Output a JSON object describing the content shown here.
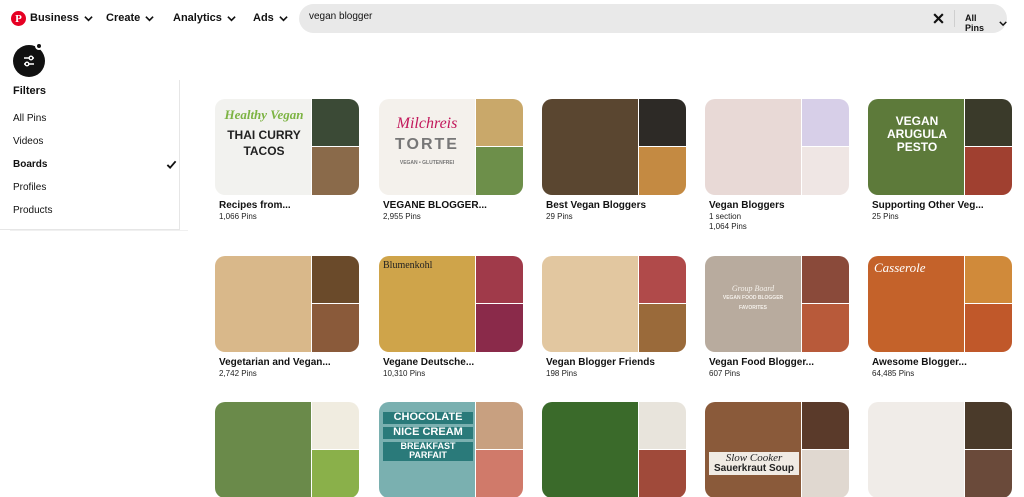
{
  "header": {
    "nav": [
      {
        "label": "Business"
      },
      {
        "label": "Create"
      },
      {
        "label": "Analytics"
      },
      {
        "label": "Ads"
      }
    ],
    "search": {
      "value": "vegan blogger",
      "scope": "All Pins"
    }
  },
  "filters": {
    "title": "Filters",
    "options": [
      "All Pins",
      "Videos",
      "Boards",
      "Profiles",
      "Products"
    ],
    "selected": "Boards"
  },
  "boards": [
    {
      "title": "Recipes from...",
      "pins": "1,066 Pins",
      "overlay": [
        "Healthy Vegan",
        "THAI CURRY",
        "TACOS"
      ],
      "colors": [
        "#f2f2ef",
        "#3b4a36",
        "#8a6a4a"
      ]
    },
    {
      "title": "VEGANE BLOGGER...",
      "pins": "2,955 Pins",
      "overlay": [
        "Milchreis",
        "TORTE",
        "VEGAN • GLUTENFREI"
      ],
      "colors": [
        "#f4f1ec",
        "#c9a86a",
        "#6d8f4a"
      ]
    },
    {
      "title": "Best Vegan Bloggers",
      "pins": "29 Pins",
      "overlay": [],
      "colors": [
        "#5a4630",
        "#2d2a26",
        "#c48a42"
      ]
    },
    {
      "title": "Vegan Bloggers",
      "section": "1 section",
      "pins": "1,064 Pins",
      "overlay": [],
      "colors": [
        "#e8d9d6",
        "#d7cfe8",
        "#efe6e4"
      ]
    },
    {
      "title": "Supporting Other Veg...",
      "pins": "25 Pins",
      "overlay": [
        "VEGAN",
        "ARUGULA",
        "PESTO"
      ],
      "colors": [
        "#5d7a3a",
        "#3a3a2a",
        "#a04030"
      ]
    },
    {
      "title": "Vegetarian and Vegan...",
      "pins": "2,742 Pins",
      "overlay": [],
      "colors": [
        "#d9b88a",
        "#6a4a2a",
        "#8a5a3a"
      ]
    },
    {
      "title": "Vegane Deutsche...",
      "pins": "10,310 Pins",
      "overlay": [
        "Blumenkohl"
      ],
      "colors": [
        "#cfa44a",
        "#a03a4a",
        "#8a2a4a"
      ]
    },
    {
      "title": "Vegan Blogger Friends",
      "pins": "198 Pins",
      "overlay": [],
      "colors": [
        "#e2c7a0",
        "#b04a4a",
        "#9a6a3a"
      ]
    },
    {
      "title": "Vegan Food Blogger...",
      "pins": "607 Pins",
      "overlay": [
        "Group Board",
        "VEGAN FOOD BLOGGER",
        "FAVORITES"
      ],
      "colors": [
        "#b8ab9e",
        "#8a4a3a",
        "#b85a3a"
      ]
    },
    {
      "title": "Awesome Blogger...",
      "pins": "64,485 Pins",
      "overlay": [
        "Casserole"
      ],
      "colors": [
        "#c4622a",
        "#d08a3a",
        "#c0582a"
      ]
    },
    {
      "title": "",
      "pins": "",
      "overlay": [],
      "colors": [
        "#6a8a4a",
        "#f0ece0",
        "#8ab04a"
      ]
    },
    {
      "title": "",
      "pins": "",
      "overlay": [
        "CHOCOLATE",
        "NICE CREAM",
        "BREAKFAST PARFAIT"
      ],
      "colors": [
        "#7ab0b0",
        "#c8a080",
        "#d07a6a"
      ]
    },
    {
      "title": "",
      "pins": "",
      "overlay": [],
      "colors": [
        "#3a6a2a",
        "#e8e4dc",
        "#a04a3a"
      ]
    },
    {
      "title": "",
      "pins": "",
      "overlay": [
        "Slow Cooker",
        "Sauerkraut Soup"
      ],
      "colors": [
        "#8a5a3a",
        "#5a3a2a",
        "#e0d8d0"
      ]
    },
    {
      "title": "",
      "pins": "",
      "overlay": [],
      "colors": [
        "#f0ece8",
        "#4a3a2a",
        "#6a4a3a"
      ]
    }
  ]
}
